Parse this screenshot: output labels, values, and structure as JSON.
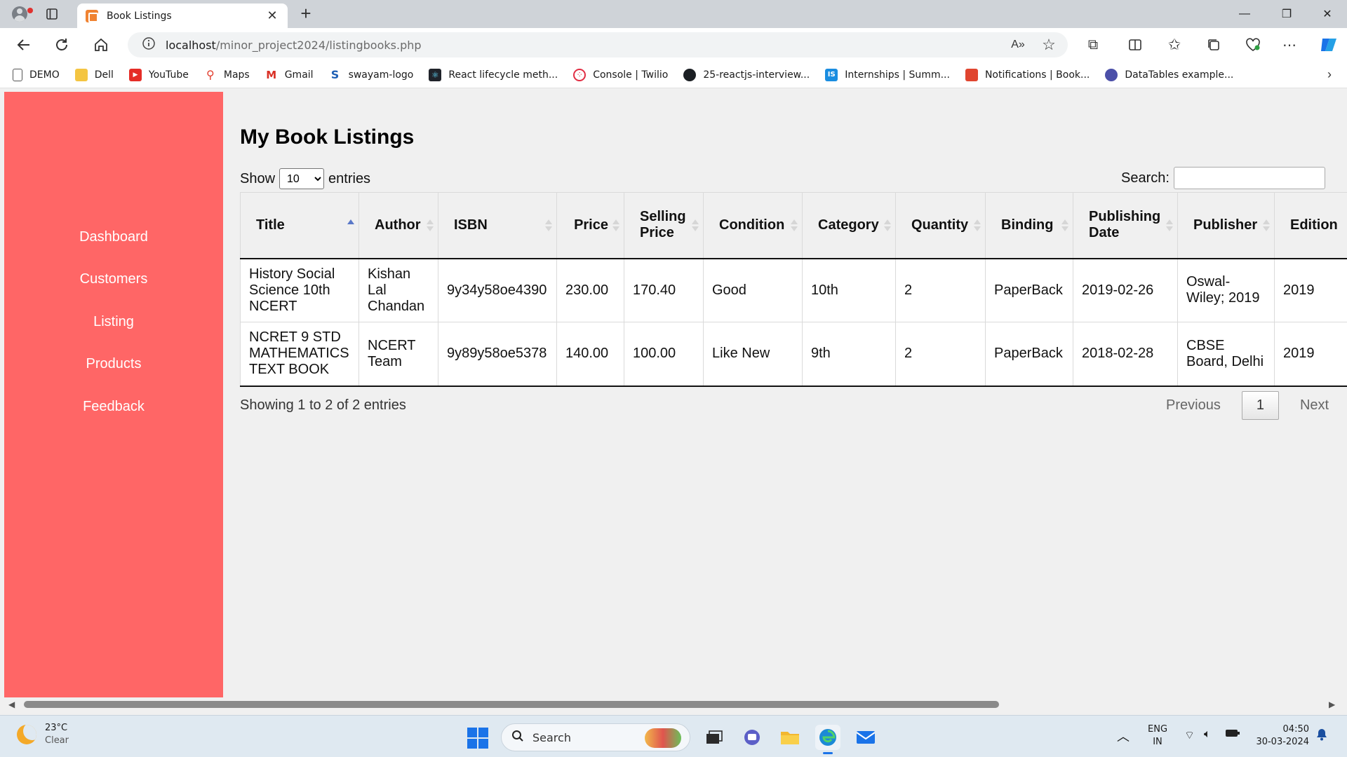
{
  "browser": {
    "tab_title": "Book Listings",
    "address_host": "localhost",
    "address_path": "/minor_project2024/listingbooks.php",
    "bookmarks": [
      {
        "label": "DEMO",
        "icon": "page-icon"
      },
      {
        "label": "Dell",
        "icon": "folder-icon"
      },
      {
        "label": "YouTube",
        "icon": "youtube-icon"
      },
      {
        "label": "Maps",
        "icon": "maps-pin-icon"
      },
      {
        "label": "Gmail",
        "icon": "gmail-icon"
      },
      {
        "label": "swayam-logo",
        "icon": "swayam-icon"
      },
      {
        "label": "React lifecycle meth...",
        "icon": "react-icon"
      },
      {
        "label": "Console | Twilio",
        "icon": "twilio-icon"
      },
      {
        "label": "25-reactjs-interview...",
        "icon": "github-icon"
      },
      {
        "label": "Internships | Summ...",
        "icon": "internshala-icon"
      },
      {
        "label": "Notifications | Book...",
        "icon": "books-icon"
      },
      {
        "label": "DataTables example...",
        "icon": "datatables-icon"
      }
    ]
  },
  "sidebar": {
    "items": [
      {
        "label": "Dashboard"
      },
      {
        "label": "Customers"
      },
      {
        "label": "Listing"
      },
      {
        "label": "Products"
      },
      {
        "label": "Feedback"
      }
    ]
  },
  "page": {
    "title": "My Book Listings",
    "length_prefix": "Show",
    "length_value": "10",
    "length_suffix": "entries",
    "search_label": "Search:",
    "search_value": "",
    "info": "Showing 1 to 2 of 2 entries",
    "pagination": {
      "previous": "Previous",
      "current": "1",
      "next": "Next"
    }
  },
  "table": {
    "columns": [
      "Title",
      "Author",
      "ISBN",
      "Price",
      "Selling Price",
      "Condition",
      "Category",
      "Quantity",
      "Binding",
      "Publishing Date",
      "Publisher",
      "Edition"
    ],
    "rows": [
      [
        "History Social Science 10th NCERT",
        "Kishan Lal Chandan",
        "9y34y58oe4390",
        "230.00",
        "170.40",
        "Good",
        "10th",
        "2",
        "PaperBack",
        "2019-02-26",
        "Oswal-Wiley; 2019",
        "2019"
      ],
      [
        "NCRET 9 STD MATHEMATICS TEXT BOOK",
        "NCERT Team",
        "9y89y58oe5378",
        "140.00",
        "100.00",
        "Like New",
        "9th",
        "2",
        "PaperBack",
        "2018-02-28",
        "CBSE Board, Delhi",
        "2019"
      ]
    ]
  },
  "taskbar": {
    "temperature": "23°C",
    "weather": "Clear",
    "search_placeholder": "Search",
    "language": "ENG",
    "region": "IN",
    "time": "04:50",
    "date": "30-03-2024"
  },
  "colors": {
    "sidebar_bg": "#ff6666",
    "sort_active": "#5a78c8"
  }
}
